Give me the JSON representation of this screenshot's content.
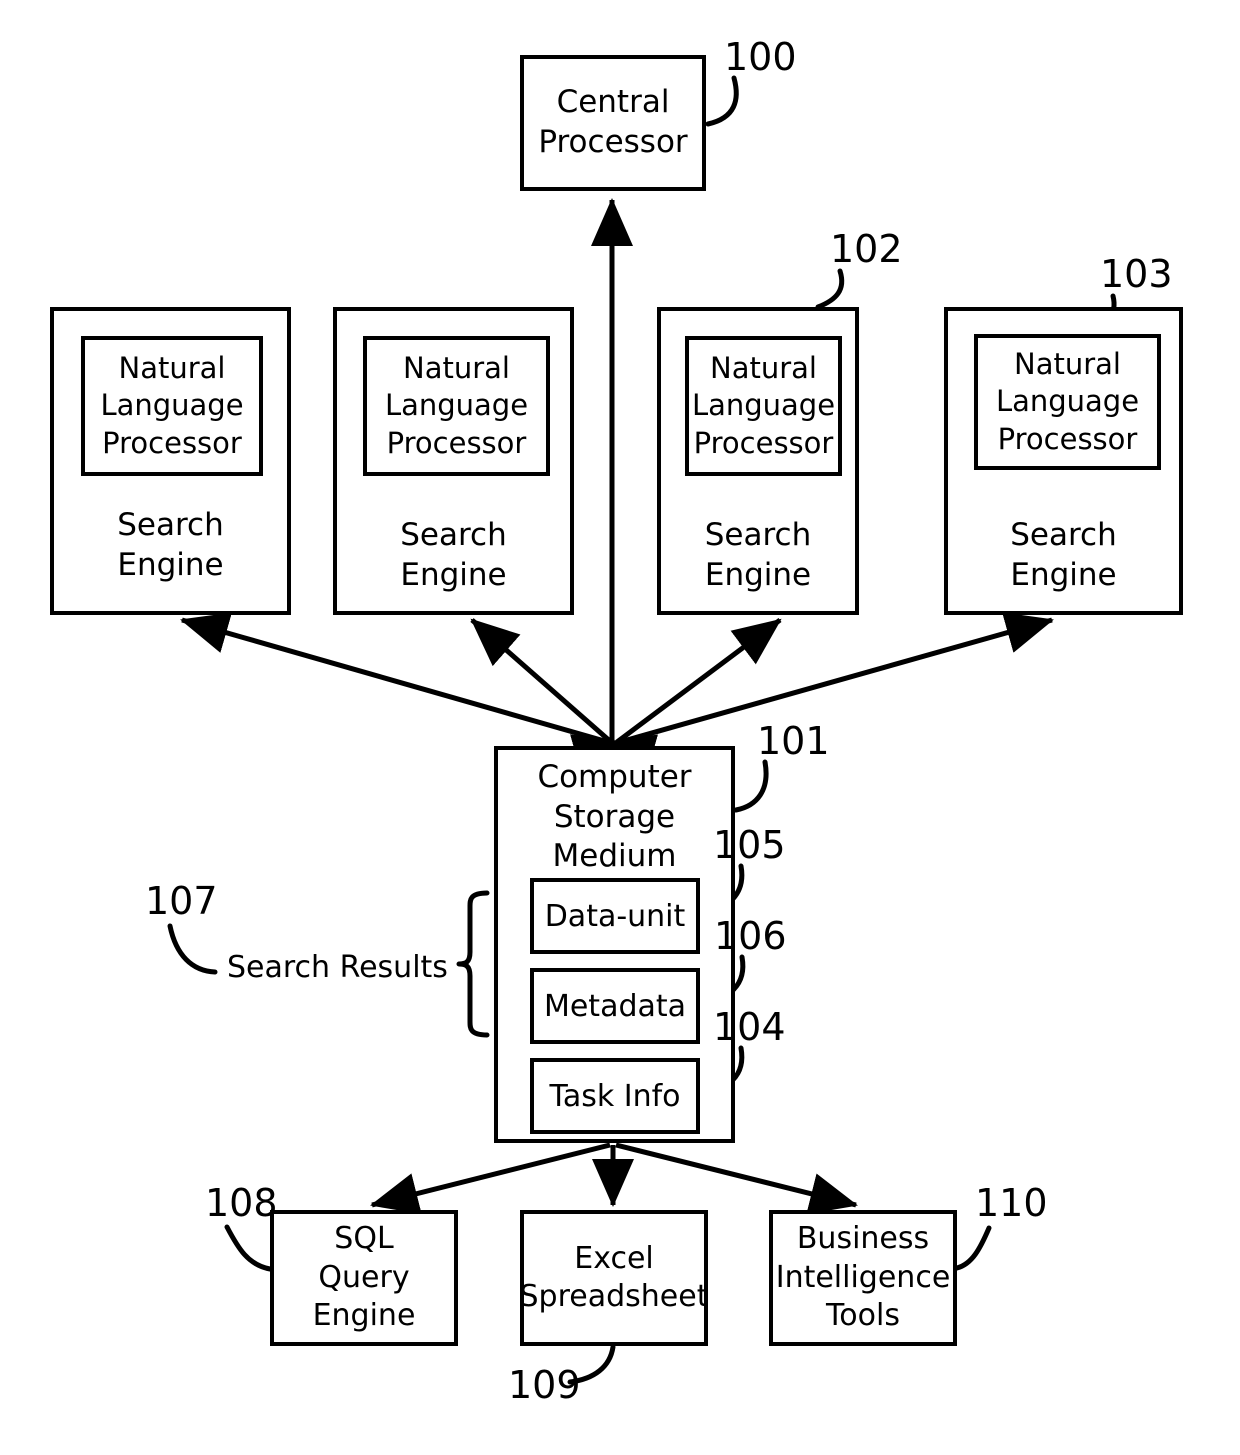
{
  "diagram": {
    "title": "Search system architecture block diagram",
    "background_color": "#ffffff",
    "line_color": "#000000"
  },
  "nodes": {
    "central_processor": {
      "label": "Central\nProcessor",
      "ref": "100"
    },
    "storage_medium": {
      "label": "Computer\nStorage\nMedium",
      "ref": "101",
      "slots": [
        {
          "label": "Data-unit",
          "ref": "105"
        },
        {
          "label": "Metadata",
          "ref": "106"
        },
        {
          "label": "Task Info",
          "ref": "104"
        }
      ],
      "bracket_label": "Search Results",
      "bracket_ref": "107"
    },
    "search_engines": [
      {
        "nlp_label": "Natural\nLanguage\nProcessor",
        "engine_label": "Search\nEngine",
        "ref": ""
      },
      {
        "nlp_label": "Natural\nLanguage\nProcessor",
        "engine_label": "Search\nEngine",
        "ref": ""
      },
      {
        "nlp_label": "Natural\nLanguage\nProcessor",
        "engine_label": "Search\nEngine",
        "ref": "102"
      },
      {
        "nlp_label": "Natural\nLanguage\nProcessor",
        "engine_label": "Search\nEngine",
        "ref": "103"
      }
    ],
    "outputs": [
      {
        "label": "SQL\nQuery\nEngine",
        "ref": "108"
      },
      {
        "label": "Excel\nSpreadsheet",
        "ref": "109"
      },
      {
        "label": "Business\nIntelligence\nTools",
        "ref": "110"
      }
    ]
  },
  "reference_numerals": {
    "n100": "100",
    "n101": "101",
    "n102": "102",
    "n103": "103",
    "n104": "104",
    "n105": "105",
    "n106": "106",
    "n107": "107",
    "n108": "108",
    "n109": "109",
    "n110": "110"
  }
}
